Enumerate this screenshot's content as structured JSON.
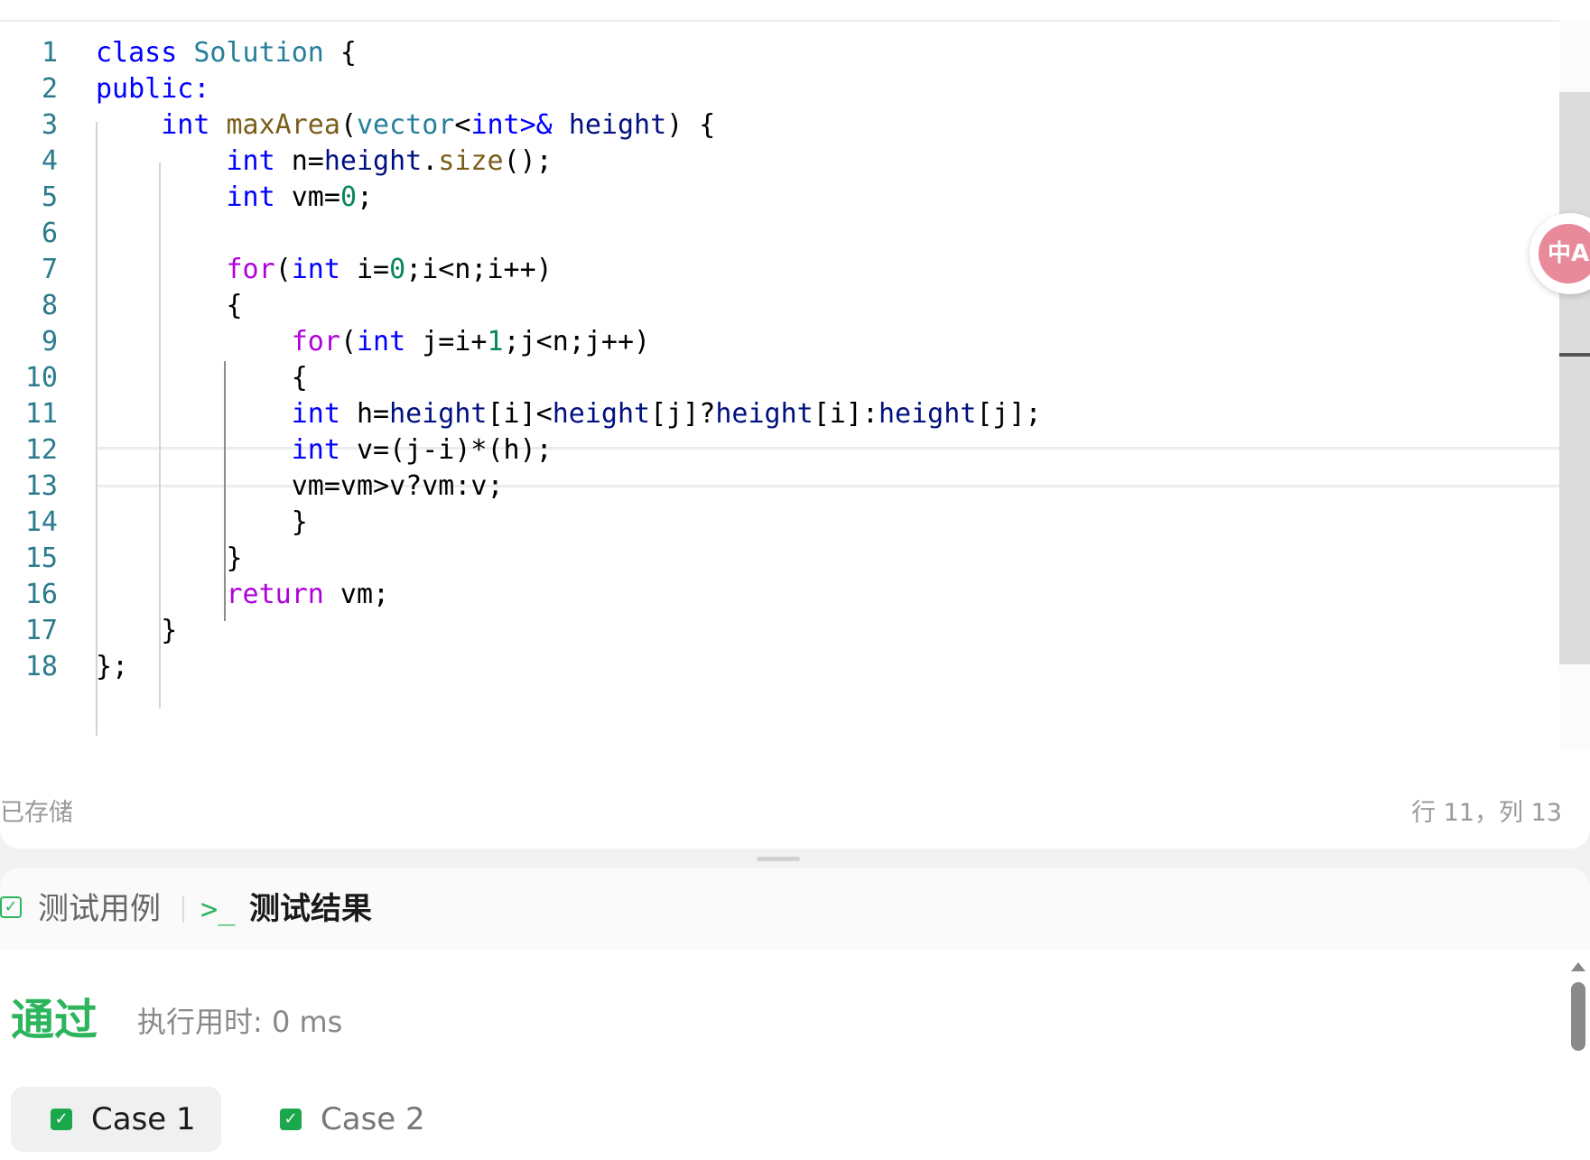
{
  "editor": {
    "lines": [
      {
        "n": "1",
        "tokens": [
          [
            "k",
            "class"
          ],
          [
            "p",
            " "
          ],
          [
            "t",
            "Solution"
          ],
          [
            "p",
            " {"
          ]
        ]
      },
      {
        "n": "2",
        "tokens": [
          [
            "k",
            "public:"
          ]
        ]
      },
      {
        "n": "3",
        "tokens": [
          [
            "p",
            "    "
          ],
          [
            "k",
            "int"
          ],
          [
            "p",
            " "
          ],
          [
            "f",
            "maxArea"
          ],
          [
            "p",
            "("
          ],
          [
            "t",
            "vector"
          ],
          [
            "p",
            "<"
          ],
          [
            "k",
            "int"
          ],
          [
            "k",
            ">&"
          ],
          [
            "p",
            " "
          ],
          [
            "v",
            "height"
          ],
          [
            "p",
            ") {"
          ]
        ]
      },
      {
        "n": "4",
        "tokens": [
          [
            "p",
            "        "
          ],
          [
            "k",
            "int"
          ],
          [
            "p",
            " n="
          ],
          [
            "v",
            "height"
          ],
          [
            "p",
            "."
          ],
          [
            "f",
            "size"
          ],
          [
            "p",
            "();"
          ]
        ]
      },
      {
        "n": "5",
        "tokens": [
          [
            "p",
            "        "
          ],
          [
            "k",
            "int"
          ],
          [
            "p",
            " vm="
          ],
          [
            "n",
            "0"
          ],
          [
            "p",
            ";"
          ]
        ]
      },
      {
        "n": "6",
        "tokens": []
      },
      {
        "n": "7",
        "tokens": [
          [
            "p",
            "        "
          ],
          [
            "c",
            "for"
          ],
          [
            "p",
            "("
          ],
          [
            "k",
            "int"
          ],
          [
            "p",
            " i="
          ],
          [
            "n",
            "0"
          ],
          [
            "p",
            ";i<n;i++)"
          ]
        ]
      },
      {
        "n": "8",
        "tokens": [
          [
            "p",
            "        {"
          ]
        ]
      },
      {
        "n": "9",
        "tokens": [
          [
            "p",
            "            "
          ],
          [
            "c",
            "for"
          ],
          [
            "p",
            "("
          ],
          [
            "k",
            "int"
          ],
          [
            "p",
            " j=i+"
          ],
          [
            "n",
            "1"
          ],
          [
            "p",
            ";j<n;j++)"
          ]
        ]
      },
      {
        "n": "10",
        "tokens": [
          [
            "p",
            "            {"
          ]
        ]
      },
      {
        "n": "11",
        "tokens": [
          [
            "p",
            "            "
          ],
          [
            "k",
            "int"
          ],
          [
            "p",
            " h="
          ],
          [
            "v",
            "height"
          ],
          [
            "p",
            "[i]<"
          ],
          [
            "v",
            "height"
          ],
          [
            "p",
            "[j]?"
          ],
          [
            "v",
            "height"
          ],
          [
            "p",
            "[i]:"
          ],
          [
            "v",
            "height"
          ],
          [
            "p",
            "[j];"
          ]
        ]
      },
      {
        "n": "12",
        "tokens": [
          [
            "p",
            "            "
          ],
          [
            "k",
            "int"
          ],
          [
            "p",
            " v=(j-i)*(h);"
          ]
        ]
      },
      {
        "n": "13",
        "tokens": [
          [
            "p",
            "            vm=vm>v?vm:v;"
          ]
        ]
      },
      {
        "n": "14",
        "tokens": [
          [
            "p",
            "            }"
          ]
        ]
      },
      {
        "n": "15",
        "tokens": [
          [
            "p",
            "        }"
          ]
        ]
      },
      {
        "n": "16",
        "tokens": [
          [
            "p",
            "        "
          ],
          [
            "c",
            "return"
          ],
          [
            "p",
            " vm;"
          ]
        ]
      },
      {
        "n": "17",
        "tokens": [
          [
            "p",
            "    }"
          ]
        ]
      },
      {
        "n": "18",
        "tokens": [
          [
            "p",
            "};"
          ]
        ]
      }
    ],
    "status_saved": "已存储",
    "status_cursor": "行 11，列 13",
    "translate_icon_text": "中A"
  },
  "results": {
    "tab_testcases": "测试用例",
    "tab_testresult": "测试结果",
    "terminal_glyph": ">_",
    "status": "通过",
    "runtime": "执行用时: 0 ms",
    "cases": [
      "Case 1",
      "Case 2"
    ]
  },
  "colors": {
    "keyword": "#0000ff",
    "function": "#7a5d1a",
    "type": "#267f99",
    "control": "#af00db",
    "number": "#098658",
    "variable": "#001080",
    "pass_green": "#2db55d"
  }
}
